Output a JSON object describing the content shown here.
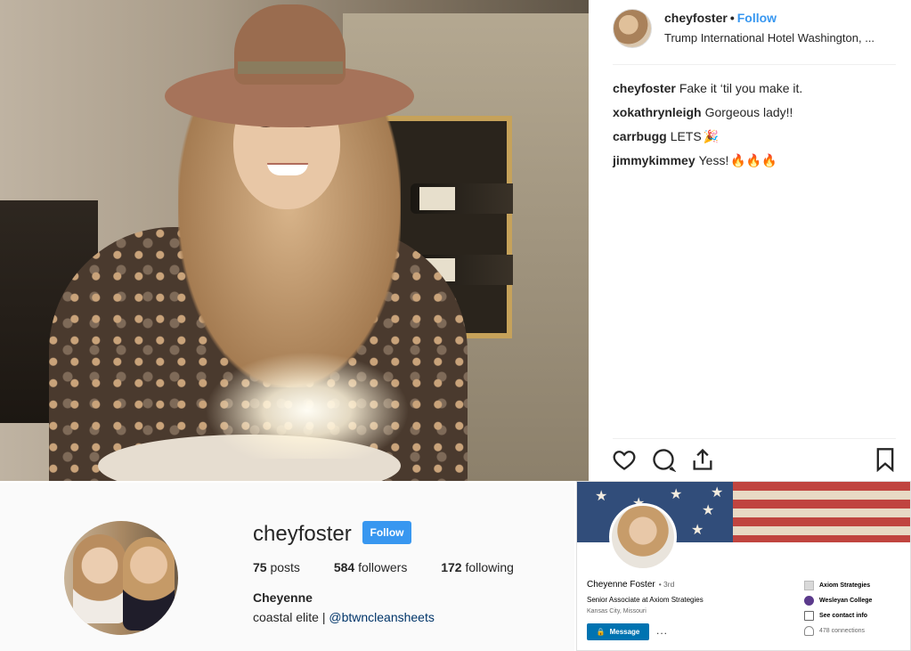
{
  "post": {
    "username": "cheyfoster",
    "separator": "•",
    "follow_label": "Follow",
    "location": "Trump International Hotel Washington, ...",
    "comments": [
      {
        "user": "cheyfoster",
        "text": "Fake it ‘til you make it.",
        "emoji": ""
      },
      {
        "user": "xokathrynleigh",
        "text": "Gorgeous lady!!",
        "emoji": ""
      },
      {
        "user": "carrbugg",
        "text": "LETS",
        "emoji": "🎉"
      },
      {
        "user": "jimmykimmey",
        "text": "Yess!",
        "emoji": "🔥🔥🔥"
      }
    ],
    "actions": [
      "heart-icon",
      "comment-icon",
      "share-icon",
      "bookmark-icon"
    ]
  },
  "profile": {
    "username": "cheyfoster",
    "follow_label": "Follow",
    "posts_count": "75",
    "posts_label": "posts",
    "followers_count": "584",
    "followers_label": "followers",
    "following_count": "172",
    "following_label": "following",
    "full_name": "Cheyenne",
    "bio_text": "coastal elite |",
    "bio_link": "@btwncleansheets"
  },
  "linkedin": {
    "name": "Cheyenne Foster",
    "degree": "• 3rd",
    "headline": "Senior Associate at Axiom Strategies",
    "location": "Kansas City, Missouri",
    "message_label": "Message",
    "more_label": "...",
    "company": "Axiom Strategies",
    "school": "Wesleyan College",
    "contact_label": "See contact info",
    "connections": "478 connections"
  },
  "colors": {
    "instagram_blue": "#3897f0",
    "linkedin_blue": "#0073b1",
    "text_dark": "#262626"
  }
}
